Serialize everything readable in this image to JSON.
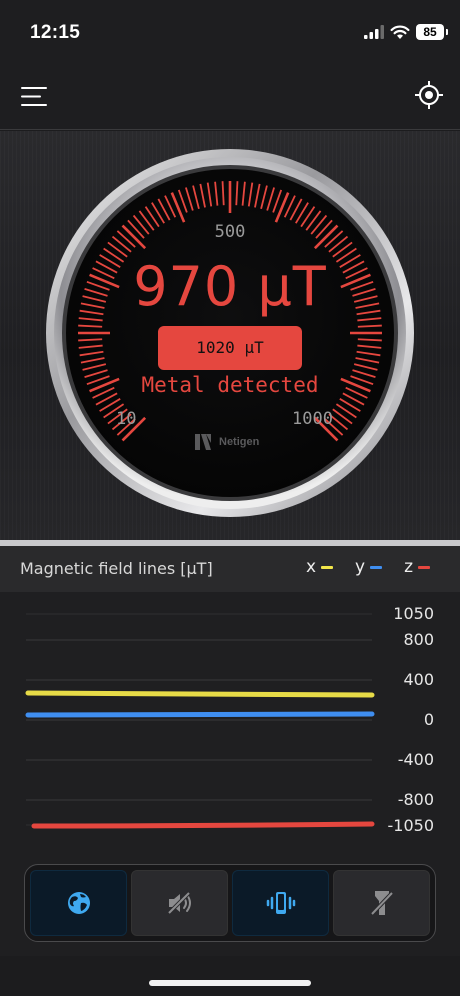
{
  "status_bar": {
    "time": "12:15",
    "battery": "85"
  },
  "nav": {
    "menu_icon": "menu-icon",
    "locate_icon": "crosshair-icon"
  },
  "gauge": {
    "value_text": "970 μT",
    "peak_text": "1020 μT",
    "status": "Metal detected",
    "label_min": "10",
    "label_mid": "500",
    "label_max": "1000",
    "brand": "Netigen",
    "accent_color": "#e5473f"
  },
  "field": {
    "title": "Magnetic field lines [μT]",
    "legend": [
      {
        "label": "x",
        "color": "#f2e64a"
      },
      {
        "label": "y",
        "color": "#3f8ef0"
      },
      {
        "label": "z",
        "color": "#e5473f"
      }
    ],
    "y_labels": [
      "1050",
      "800",
      "400",
      "0",
      "-400",
      "-800",
      "-1050"
    ]
  },
  "tools": [
    {
      "icon": "globe-icon",
      "active": true
    },
    {
      "icon": "sound-off-icon",
      "active": false
    },
    {
      "icon": "vibrate-icon",
      "active": true
    },
    {
      "icon": "flashlight-off-icon",
      "active": false
    }
  ]
}
